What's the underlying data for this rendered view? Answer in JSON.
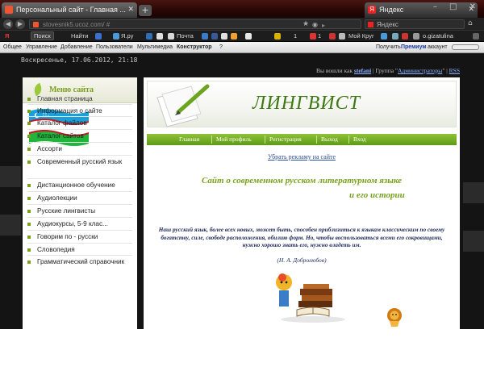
{
  "browser": {
    "tabs": [
      {
        "label": "Персональный сайт - Главная ...",
        "active": true
      },
      {
        "label": "Яндекс",
        "active": false
      }
    ],
    "new_tab": "+",
    "window_controls": "– □ ✕",
    "url": "stovesnik5.ucoz.com/",
    "url_suffix": "#",
    "search_placeholder": "Яндекс",
    "icons": [
      "back-arrow-icon",
      "forward-arrow-icon",
      "star-icon",
      "rss-icon",
      "home-icon"
    ]
  },
  "yandex_bar": {
    "logo": "Я",
    "search_button": "Поиск",
    "items": [
      "Найти",
      "Я.ру",
      "Почта",
      "Мой Круг",
      "o.gizatulina"
    ],
    "count_mail": "1",
    "count_other": "1"
  },
  "ucoz_bar": {
    "items": [
      "Общее",
      "Управление",
      "Добавление",
      "Пользователи",
      "Мультимедиа"
    ],
    "constructor": "Конструктор",
    "help": "?",
    "premium_prefix": "Получить",
    "premium_link": "Премиум",
    "premium_suffix": "аккаунт"
  },
  "page": {
    "datetime": "Воскресенье, 17.06.2012, 21:18",
    "login_prefix": "Вы вошли как",
    "user": "stefani",
    "group_prefix": "| Группа \"",
    "group": "Администраторы",
    "group_suffix": "\" |",
    "rss": "RSS"
  },
  "sidebar": {
    "title": "Меню сайта",
    "items": [
      "Главная страница",
      "Информация о сайте",
      "Каталог файлов",
      "Каталог сайтов",
      "Ассорти",
      "Современный русский язык",
      "Дистанционное обучение",
      "Аудиолекции",
      "Русские лингвисты",
      "Аудиокурсы, 5-9 клас...",
      "Говорим по - русски",
      "Словопедия",
      "Грамматический справочник"
    ]
  },
  "main": {
    "logo": "ЛИНГВИСТ",
    "nav": [
      "Главная",
      "Мой профиль",
      "Регистрация",
      "Выход",
      "Вход"
    ],
    "ad_link": "Убрать рекламу на сайте",
    "headline_line1": "Сайт о современном русском литературном языке",
    "headline_line2": "и его истории",
    "quote": "Наш русский язык, более всех новых, может быть, способен приблизиться к языкам классическим по своему богатству, силе, свободе расположения, обилию форм. Но, чтобы воспользоваться всеми его сокровищами, нужно хорошо знать его, нужно владеть им.",
    "quote_author": "(Н. А. Добролюбов)"
  },
  "colors": {
    "accent_green": "#77a21d",
    "nav_green": "#6aa51d",
    "logo_green": "#3e7a14",
    "quote_navy": "#1e2a5a",
    "page_dark": "#141414"
  }
}
